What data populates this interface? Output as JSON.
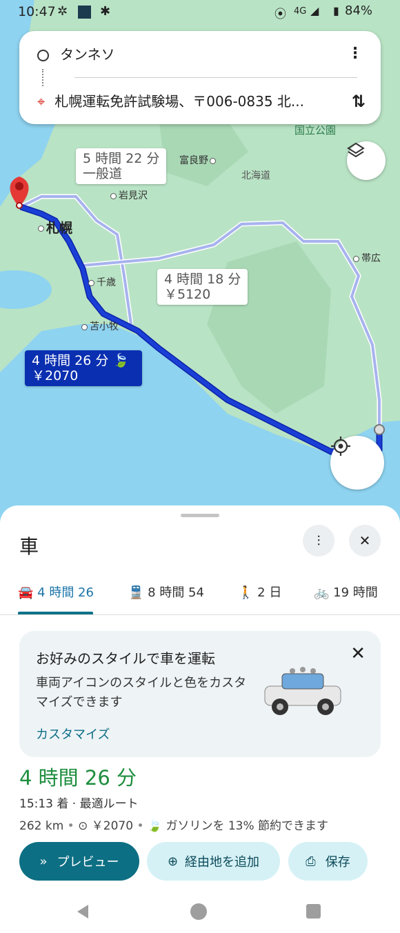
{
  "status_bar": {
    "time": "10:47",
    "network": "4G",
    "battery": "84%"
  },
  "search": {
    "origin": "タンネソ",
    "destination": "札幌運転免許試験場、〒006-0835 北..."
  },
  "map": {
    "places": {
      "national_park": "国立公園",
      "furano": "富良野",
      "hokkaido": "北海道",
      "iwamizawa": "岩見沢",
      "sapporo": "札幌",
      "obihiro": "帯広",
      "chitose": "千歳",
      "tomakomai": "苫小牧"
    },
    "routes": [
      {
        "duration": "5 時間 22 分",
        "note": "一般道"
      },
      {
        "duration": "4 時間 18 分",
        "note": "￥5120"
      },
      {
        "duration": "4 時間 26 分",
        "note": "￥2070",
        "selected": true
      }
    ]
  },
  "sheet": {
    "title": "車",
    "tabs": [
      {
        "label": "4 時間 26",
        "icon": "car-icon"
      },
      {
        "label": "8 時間 54",
        "icon": "train-icon"
      },
      {
        "label": "2 日",
        "icon": "walk-icon"
      },
      {
        "label": "19 時間",
        "icon": "bike-icon"
      }
    ],
    "promo": {
      "title": "お好みのスタイルで車を運転",
      "description": "車両アイコンのスタイルと色をカスタマイズできます",
      "link": "カスタマイズ"
    },
    "summary": {
      "duration": "4 時間 26 分",
      "eta": "15:13 着 · 最適ルート",
      "distance": "262 km",
      "toll": "￥2070",
      "eco": "ガソリンを 13% 節約できます"
    },
    "buttons": {
      "preview": "プレビュー",
      "add_waypoint": "経由地を追加",
      "save": "保存"
    }
  },
  "colors": {
    "route_selected": "#1a3fd6",
    "route_alt": "#a7b3ee",
    "water": "#8ed3f0",
    "land": "#b9e3c5",
    "accent": "#0d6f83",
    "eta_green": "#1e8e3e"
  }
}
